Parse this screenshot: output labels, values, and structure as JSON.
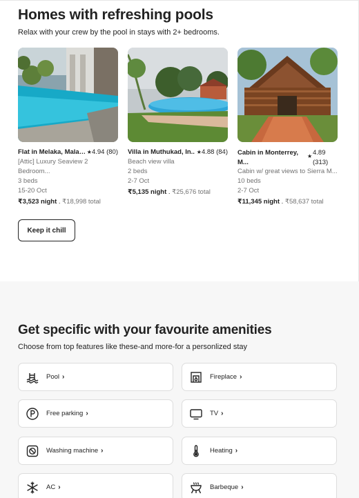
{
  "pools": {
    "title": "Homes with refreshing pools",
    "subtitle": "Relax with your crew by the pool in stays with 2+ bedrooms.",
    "cards": [
      {
        "title": "Flat in Melaka, Malay...",
        "rating": "4.94 (80)",
        "desc": "[Attic] Luxury Seaview 2 Bedroom...",
        "beds": "3 beds",
        "dates": "15-20 Oct",
        "night": "₹3,523 night",
        "total": "₹18,998 total"
      },
      {
        "title": "Villa in Muthukad, In...",
        "rating": "4.88 (84)",
        "desc": "Beach view villa",
        "beds": "2 beds",
        "dates": "2-7 Oct",
        "night": "₹5,135 night",
        "total": "₹25,676 total"
      },
      {
        "title": "Cabin in Monterrey, M...",
        "rating_value": "4.89",
        "rating_count": "(313)",
        "desc": "Cabin w/ great views to Sierra M...",
        "beds": "10 beds",
        "dates": "2-7 Oct",
        "night": "₹11,345 night",
        "total": "₹58,637 total"
      }
    ],
    "button": "Keep it chill"
  },
  "amenities": {
    "title": "Get specific with your favourite amenities",
    "subtitle": "Choose from top features like these-and more-for a personlized stay",
    "items": [
      {
        "label": "Pool",
        "icon": "pool-icon"
      },
      {
        "label": "Fireplace",
        "icon": "fireplace-icon"
      },
      {
        "label": "Free parking",
        "icon": "parking-icon"
      },
      {
        "label": "TV",
        "icon": "tv-icon"
      },
      {
        "label": "Washing machine",
        "icon": "washing-machine-icon"
      },
      {
        "label": "Heating",
        "icon": "thermometer-icon"
      },
      {
        "label": "AC",
        "icon": "snowflake-icon"
      },
      {
        "label": "Barbeque",
        "icon": "barbeque-icon"
      }
    ]
  },
  "separators": {
    "dot": "."
  },
  "icons": {
    "star": "★",
    "chevron": "›"
  }
}
